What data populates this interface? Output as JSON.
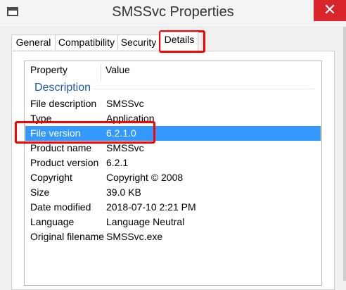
{
  "window": {
    "title": "SMSSvc Properties",
    "close_glyph": "✕",
    "icon": "window-icon"
  },
  "tabs": [
    {
      "label": "General",
      "active": false
    },
    {
      "label": "Compatibility",
      "active": false
    },
    {
      "label": "Security",
      "active": false
    },
    {
      "label": "Details",
      "active": true
    }
  ],
  "details": {
    "columns": {
      "property": "Property",
      "value": "Value"
    },
    "group": "Description",
    "rows": [
      {
        "property": "File description",
        "value": "SMSSvc"
      },
      {
        "property": "Type",
        "value": "Application"
      },
      {
        "property": "File version",
        "value": "6.2.1.0",
        "selected": true
      },
      {
        "property": "Product name",
        "value": "SMSSvc"
      },
      {
        "property": "Product version",
        "value": "6.2.1"
      },
      {
        "property": "Copyright",
        "value": "Copyright ©  2008"
      },
      {
        "property": "Size",
        "value": "39.0 KB"
      },
      {
        "property": "Date modified",
        "value": "2018-07-10 2:21 PM"
      },
      {
        "property": "Language",
        "value": "Language Neutral"
      },
      {
        "property": "Original filename",
        "value": "SMSSvc.exe"
      }
    ]
  },
  "colors": {
    "selection": "#3399ff",
    "annotation": "#ff0000",
    "close_button": "#d9252c",
    "group_label": "#1e5aa8"
  }
}
